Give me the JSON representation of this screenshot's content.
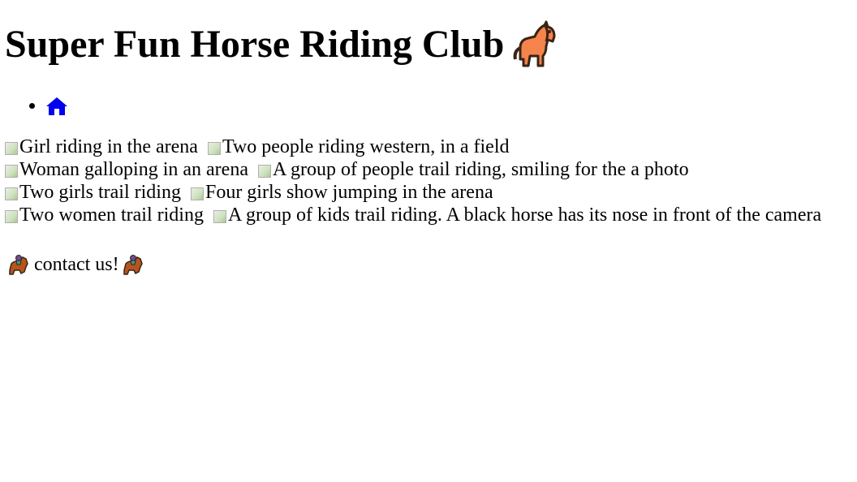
{
  "header": {
    "title": "Super Fun Horse Riding Club",
    "title_icon": "horse-icon"
  },
  "nav": {
    "items": [
      {
        "icon": "home-icon",
        "color": "#0000ee"
      }
    ]
  },
  "gallery": {
    "rows": [
      [
        "Girl riding in the arena",
        "Two people riding western, in a field"
      ],
      [
        "Woman galloping in an arena",
        "A group of people trail riding, smiling for the a photo"
      ],
      [
        "Two girls trail riding",
        "Four girls show jumping in the arena"
      ],
      [
        "Two women trail riding",
        "A group of kids trail riding. A black horse has its nose in front of the camera"
      ]
    ]
  },
  "footer": {
    "contact_label": "contact us!",
    "left_icon": "horse-racing-icon",
    "right_icon": "horse-racing-icon"
  }
}
